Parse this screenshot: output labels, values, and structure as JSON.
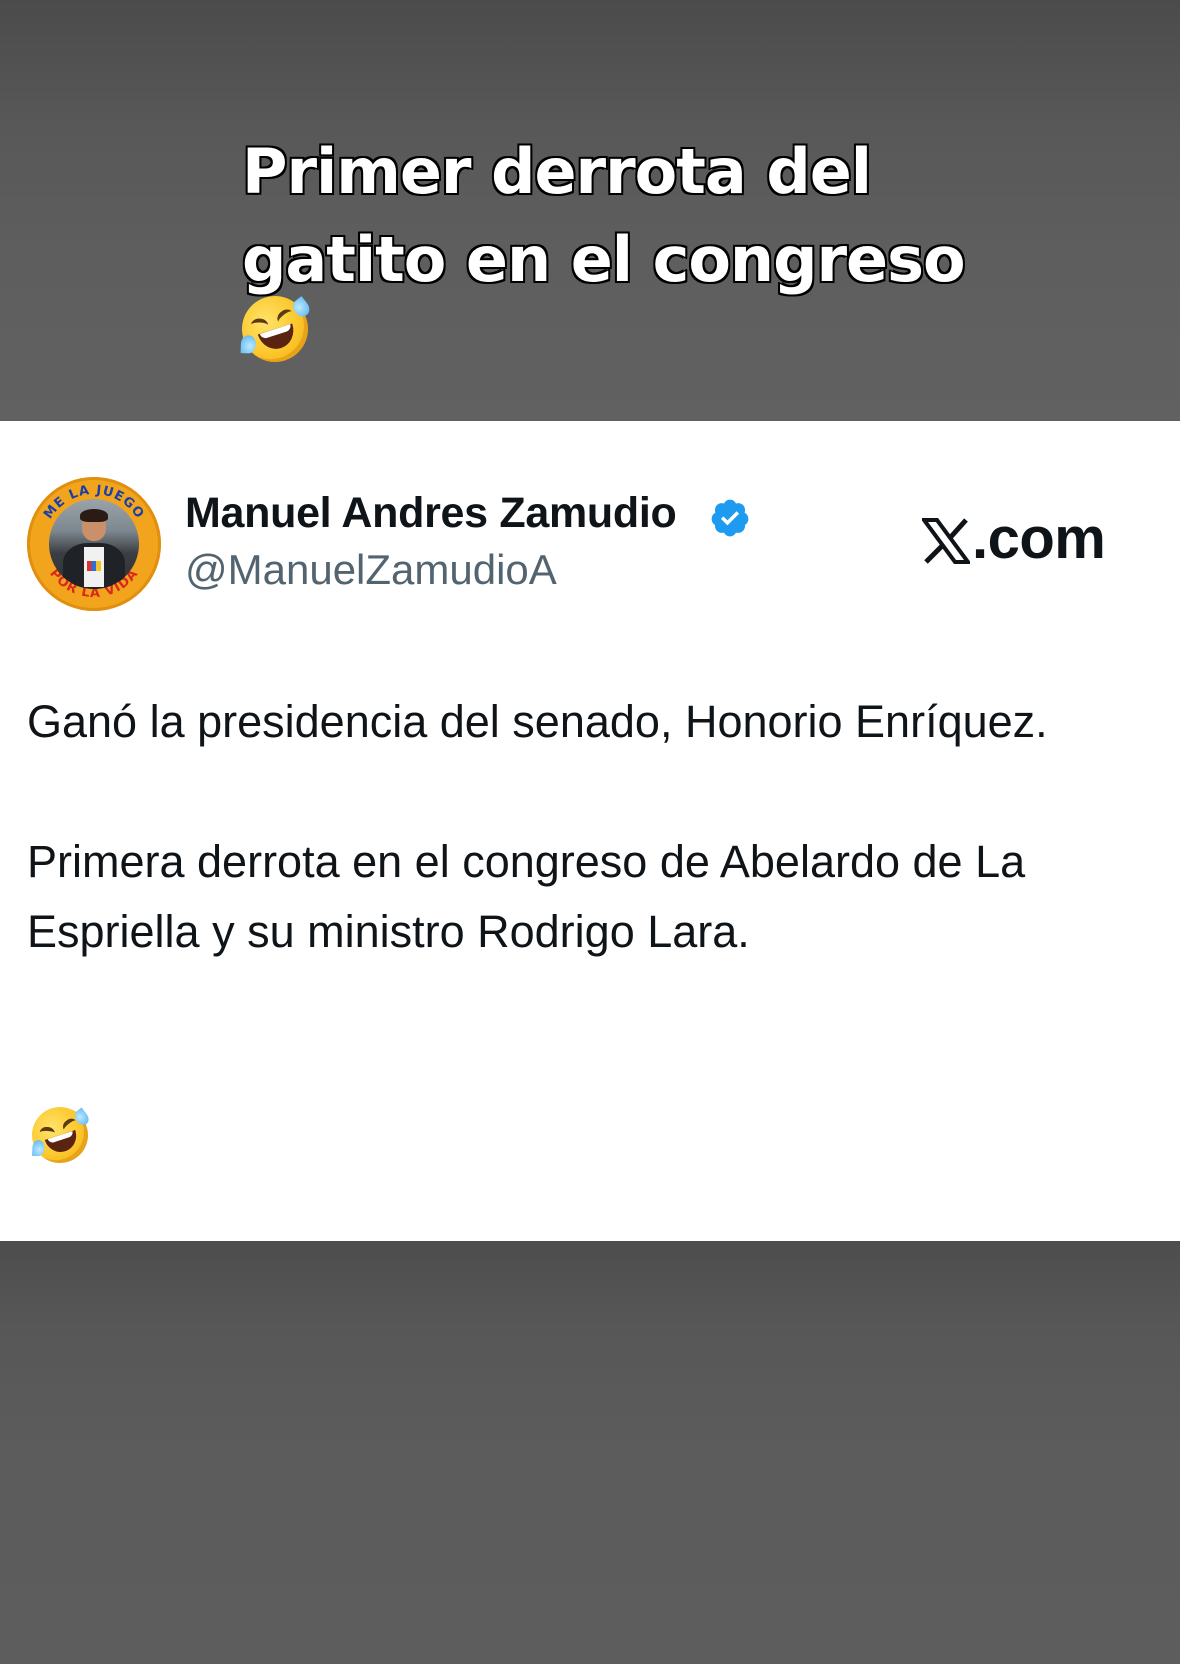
{
  "caption": {
    "line1": "Primer derrota del",
    "line2": "gatito en el congreso",
    "emoji": "rolling-on-the-floor-laughing"
  },
  "tweet": {
    "display_name": "Manuel Andres Zamudio",
    "handle": "@ManuelZamudioA",
    "verified": true,
    "verified_color": "#1d9bf0",
    "avatar": {
      "ring_text_top": "ME LA JUEGO",
      "ring_text_bottom": "POR LA VIDA",
      "ring_color": "#f2a51c"
    },
    "source_label": ".com",
    "source_icon": "x-logo-icon",
    "paragraph1": "Ganó la presidencia del senado, Honorio Enríquez.",
    "paragraph2": "Primera derrota en el congreso de Abelardo de La Espriella y su ministro Rodrigo Lara.",
    "trailing_emoji": "rolling-on-the-floor-laughing"
  },
  "colors": {
    "card_bg": "#ffffff",
    "text_primary": "#0f1419",
    "text_secondary": "#536471",
    "background": "#5e5e5e"
  }
}
